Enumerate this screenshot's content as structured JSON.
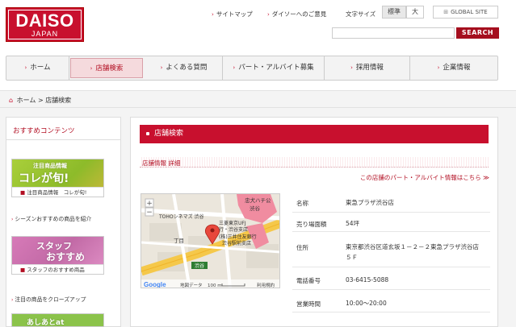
{
  "logo": {
    "main": "DAISO",
    "sub": "JAPAN"
  },
  "top_links": {
    "sitemap": "サイトマップ",
    "opinion": "ダイソーへのご意見",
    "font_size_label": "文字サイズ",
    "font_standard": "標準",
    "font_large": "大",
    "global_site": "GLOBAL SITE"
  },
  "search": {
    "placeholder": "",
    "button": "SEARCH"
  },
  "nav": [
    {
      "label": "ホーム"
    },
    {
      "label": "店舗検索"
    },
    {
      "label": "よくある質問"
    },
    {
      "label": "パート・アルバイト募集"
    },
    {
      "label": "採用情報"
    },
    {
      "label": "企業情報"
    }
  ],
  "breadcrumb": {
    "home": "ホーム",
    "sep": ">",
    "current": "店舗検索"
  },
  "sidebar": {
    "title": "おすすめコンテンツ",
    "banners": [
      {
        "headline": "注目商品情報",
        "big": "コレが旬!",
        "caption": "注目商品情報　コレが旬!",
        "desc": "シーズンおすすめの商品を紹介"
      },
      {
        "headline": "スタッフ",
        "big": "おすすめ",
        "caption": "スタッフのおすすめ商品",
        "desc": "注目の商品をクローズアップ"
      },
      {
        "headline": "あしあとat",
        "big": "",
        "caption": "",
        "desc": ""
      }
    ]
  },
  "main": {
    "title": "店舗検索",
    "subheader": "店舗情報 詳細",
    "job_link": "この店舗のパート・アルバイト情報はこちら ≫",
    "store": [
      {
        "label": "名称",
        "value": "東急プラザ渋谷店"
      },
      {
        "label": "売り場面積",
        "value": "54坪"
      },
      {
        "label": "住所",
        "value": "東京都渋谷区道玄坂１－２－２東急プラザ渋谷店",
        "value2": "５Ｆ"
      },
      {
        "label": "電話番号",
        "value": "03-6415-5088"
      },
      {
        "label": "営業時間",
        "value": "10:00～20:00"
      }
    ]
  },
  "map": {
    "labels": {
      "hachiko": "忠犬ハチ公",
      "shibuya_top": "渋谷",
      "toho": "TOHOシネマズ 渋谷",
      "bank1": "三菱東京UFJ",
      "bank1b": "行・渋谷支店",
      "bank2": "(株)三井住友銀行",
      "bank2b": "渋谷駅前支店",
      "chome": "丁目",
      "shibuya_badge": "渋谷",
      "google": "Google",
      "map_data": "地図データ",
      "scale": "100 m",
      "terms": "利用規約",
      "zoom_in": "+",
      "zoom_out": "−"
    }
  },
  "colors": {
    "brand_red": "#c8102e",
    "dark_red": "#a50e1e"
  }
}
